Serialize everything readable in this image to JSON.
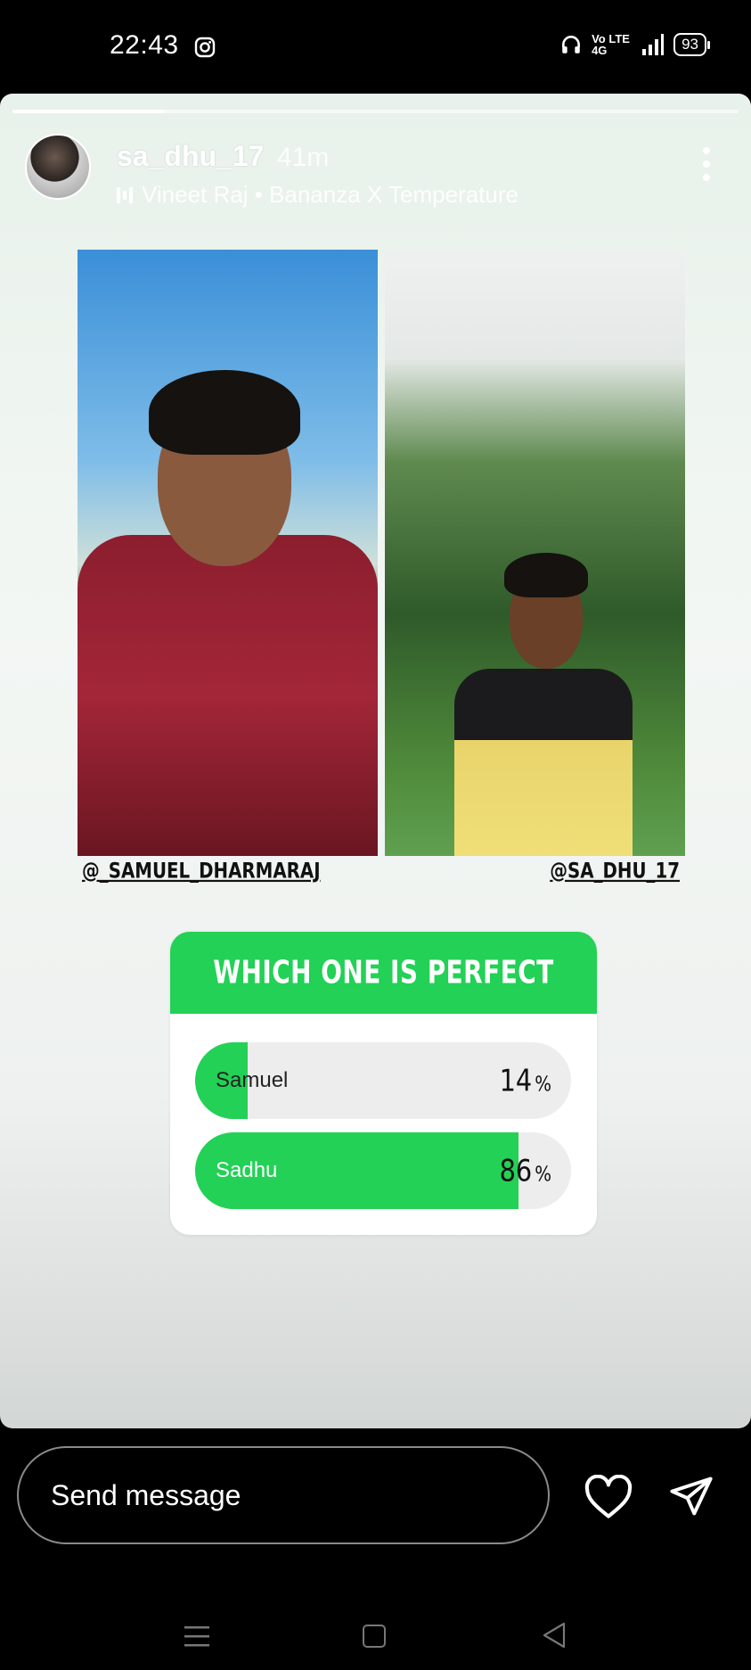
{
  "status_bar": {
    "time": "22:43",
    "network": "Vo LTE 4G",
    "battery": "93"
  },
  "story": {
    "progress": 0.21,
    "username": "sa_dhu_17",
    "time_ago": "41m",
    "music": "Vineet Raj • Bananza X Temperature",
    "tags": {
      "left": "@_SAMUEL_DHARMARAJ",
      "right": "@SA_DHU_17"
    },
    "poll": {
      "question": "WHICH ONE IS PERFECT",
      "accent": "#22d155",
      "options": [
        {
          "label": "Samuel",
          "percent": "14",
          "fill": 0.14
        },
        {
          "label": "Sadhu",
          "percent": "86",
          "fill": 0.86
        }
      ]
    }
  },
  "reply": {
    "placeholder": "Send message"
  }
}
